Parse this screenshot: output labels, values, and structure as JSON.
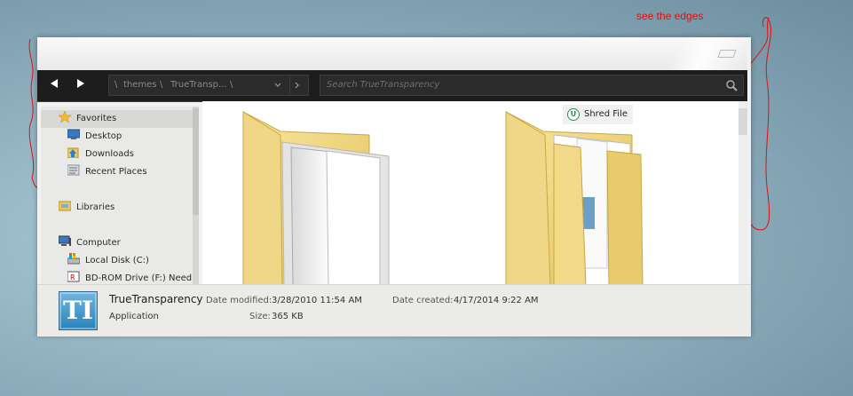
{
  "annotation": {
    "text": "see the edges",
    "color": "#e01010"
  },
  "toolbar": {
    "back_icon": "back-arrow-icon",
    "forward_icon": "forward-arrow-icon",
    "address": {
      "sep1": "\\",
      "seg1": "themes",
      "sep2": "\\",
      "seg2": "TrueTransp...",
      "sep3": "\\"
    },
    "search_placeholder": "Search TrueTransparency"
  },
  "sidebar": {
    "favorites": "Favorites",
    "desktop": "Desktop",
    "downloads": "Downloads",
    "recent": "Recent Places",
    "libraries": "Libraries",
    "computer": "Computer",
    "local_disk": "Local Disk (C:)",
    "bdrom": "BD-ROM Drive (F:) Need Fo"
  },
  "content": {
    "context_action": "Shred File",
    "items": [
      {
        "type": "folder",
        "icon": "folder-icon"
      },
      {
        "type": "folder",
        "icon": "folder-with-documents-icon"
      }
    ]
  },
  "details": {
    "name": "TrueTransparency",
    "type": "Application",
    "date_modified_label": "Date modified:",
    "date_modified": "3/28/2010 11:54 AM",
    "date_created_label": "Date created:",
    "date_created": "4/17/2014 9:22 AM",
    "size_label": "Size:",
    "size": "365 KB",
    "icon_letters": "TI"
  }
}
